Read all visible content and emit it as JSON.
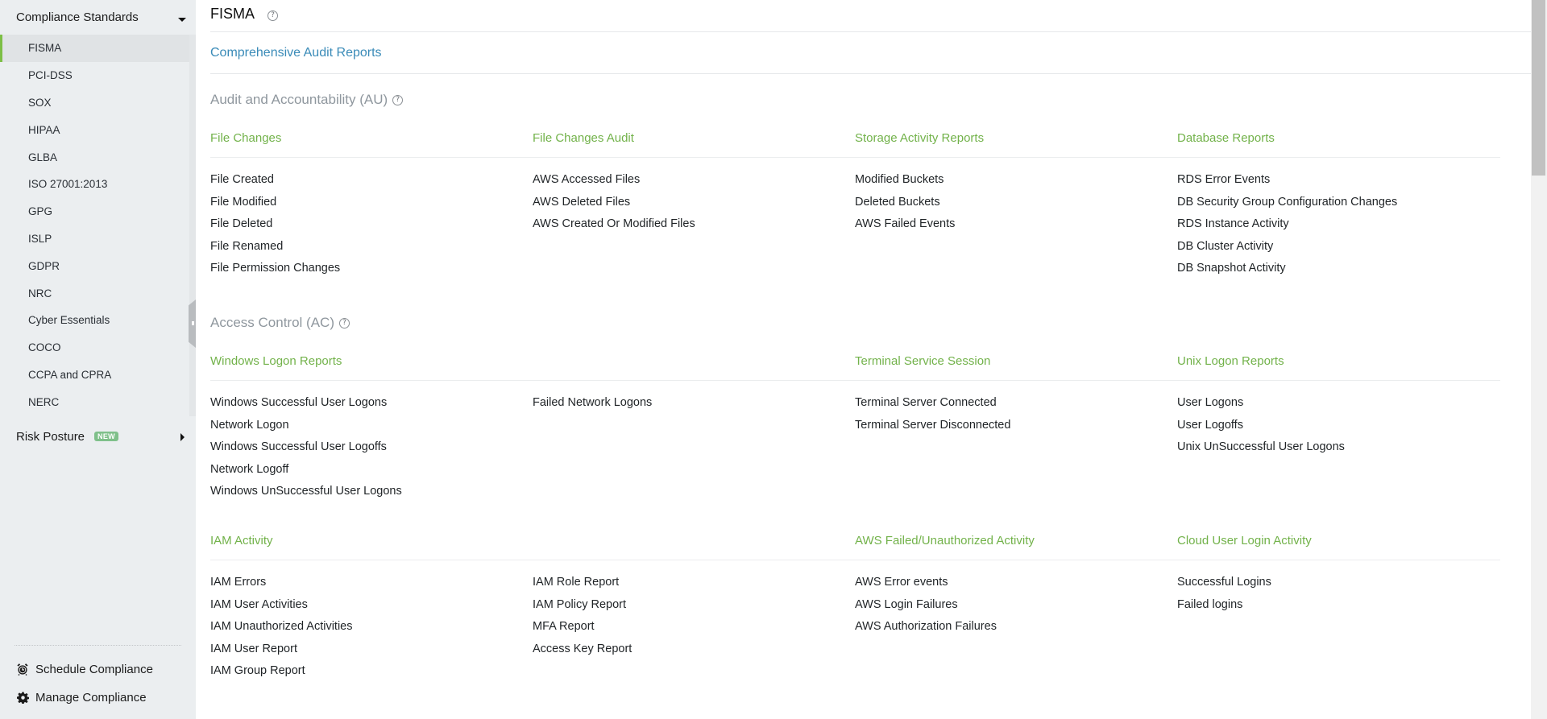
{
  "sidebar": {
    "header": "Compliance Standards",
    "items": [
      {
        "label": "FISMA",
        "active": true
      },
      {
        "label": "PCI-DSS"
      },
      {
        "label": "SOX"
      },
      {
        "label": "HIPAA"
      },
      {
        "label": "GLBA"
      },
      {
        "label": "ISO 27001:2013"
      },
      {
        "label": "GPG"
      },
      {
        "label": "ISLP"
      },
      {
        "label": "GDPR"
      },
      {
        "label": "NRC"
      },
      {
        "label": "Cyber Essentials"
      },
      {
        "label": "COCO"
      },
      {
        "label": "CCPA and CPRA"
      },
      {
        "label": "NERC"
      }
    ],
    "risk_posture": "Risk Posture",
    "new_badge": "NEW",
    "schedule": "Schedule Compliance",
    "manage": "Manage Compliance"
  },
  "main": {
    "title": "FISMA",
    "help_glyph": "?",
    "comprehensive_link": "Comprehensive Audit Reports",
    "sections": [
      {
        "title": "Audit and Accountability (AU)",
        "groups": [
          {
            "title": "File Changes",
            "reports": [
              "File Created",
              "File Modified",
              "File Deleted",
              "File Renamed",
              "File Permission Changes"
            ]
          },
          {
            "title": "File Changes Audit",
            "reports": [
              "AWS Accessed Files",
              "AWS Deleted Files",
              "AWS Created Or Modified Files"
            ]
          },
          {
            "title": "Storage Activity Reports",
            "reports": [
              "Modified Buckets",
              "Deleted Buckets",
              "AWS Failed Events"
            ]
          },
          {
            "title": "Database Reports",
            "reports": [
              "RDS Error Events",
              "DB Security Group Configuration Changes",
              "RDS Instance Activity",
              "DB Cluster Activity",
              "DB Snapshot Activity"
            ]
          }
        ]
      },
      {
        "title": "Access Control (AC)",
        "groups": [
          {
            "title": "Windows Logon Reports",
            "reports": [
              "Windows Successful User Logons",
              "Network Logon",
              "Windows Successful User Logoffs",
              "Network Logoff",
              "Windows UnSuccessful User Logons"
            ],
            "reports_col2": [
              "Failed Network Logons"
            ]
          },
          {
            "title": "Terminal Service Session",
            "reports": [
              "Terminal Server Connected",
              "Terminal Server Disconnected"
            ]
          },
          {
            "title": "Unix Logon Reports",
            "reports": [
              "User Logons",
              "User Logoffs",
              "Unix UnSuccessful User Logons"
            ]
          },
          {
            "title": "IAM Activity",
            "reports": [
              "IAM Errors",
              "IAM User Activities",
              "IAM Unauthorized Activities",
              "IAM User Report",
              "IAM Group Report"
            ],
            "reports_col2": [
              "IAM Role Report",
              "IAM Policy Report",
              "MFA Report",
              "Access Key Report"
            ]
          },
          {
            "title": "AWS Failed/Unauthorized Activity",
            "reports": [
              "AWS Error events",
              "AWS Login Failures",
              "AWS Authorization Failures"
            ]
          },
          {
            "title": "Cloud User Login Activity",
            "reports": [
              "Successful Logins",
              "Failed logins"
            ]
          }
        ]
      }
    ]
  },
  "colors": {
    "accent_green": "#7dbf46",
    "group_title_green": "#72b24a",
    "link_blue": "#3a8bb8",
    "section_gray": "#8f979e",
    "sidebar_bg": "#ebeef0"
  }
}
